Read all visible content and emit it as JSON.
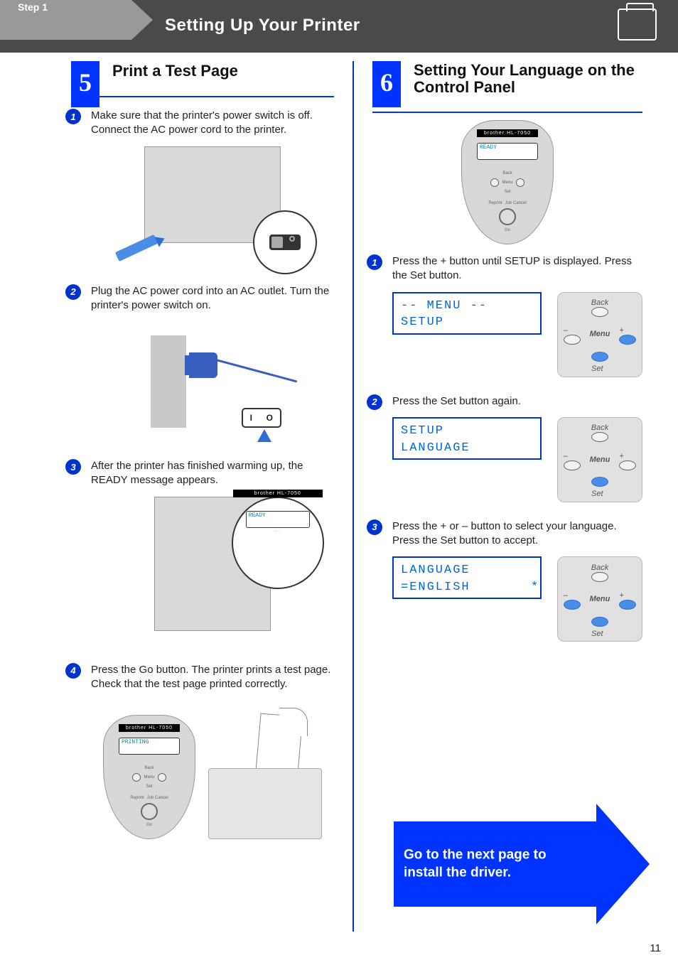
{
  "header": {
    "step_word": "Step 1",
    "title": "Setting Up Your Printer"
  },
  "left": {
    "tab_number": "5",
    "heading": "Print a Test Page",
    "steps": [
      {
        "n": "1",
        "text": "Make sure that the printer's power switch is off. Connect the AC power cord to the printer."
      },
      {
        "n": "2",
        "text": "Plug the AC power cord into an AC outlet. Turn the printer's power switch on."
      },
      {
        "n": "3",
        "text": "After the printer has finished warming up, the READY message appears."
      },
      {
        "n": "4",
        "text": "Press the Go button. The printer prints a test page.\nCheck that the test page printed correctly."
      }
    ],
    "lcd_ready": "READY",
    "lcd_printing": "PRINTING",
    "lcd_brand": "brother  HL-7050",
    "control_labels": {
      "back": "Back",
      "menu": "Menu",
      "set": "Set",
      "reprint": "Reprint",
      "jobcancel": "Job Cancel",
      "go": "Go"
    }
  },
  "right": {
    "tab_number": "6",
    "heading": "Setting Your Language on the Control Panel",
    "steps": [
      {
        "n": "1",
        "text": "Press the + button until SETUP is displayed. Press the Set button."
      },
      {
        "n": "2",
        "text": "Press the Set button again."
      },
      {
        "n": "3",
        "text": "Press the + or – button to select your language. Press the Set button to accept."
      }
    ],
    "lcd1_line1": "-- MENU --",
    "lcd1_line2": "SETUP",
    "lcd2_line1": "SETUP",
    "lcd2_line2": "LANGUAGE",
    "lcd3_line1": "LANGUAGE",
    "lcd3_line2": "=ENGLISH       *",
    "keypad_labels": {
      "back": "Back",
      "menu": "Menu",
      "set": "Set",
      "minus": "–",
      "plus": "+"
    }
  },
  "arrow_text": "Go to the next page to\ninstall the driver.",
  "page_number": "11"
}
